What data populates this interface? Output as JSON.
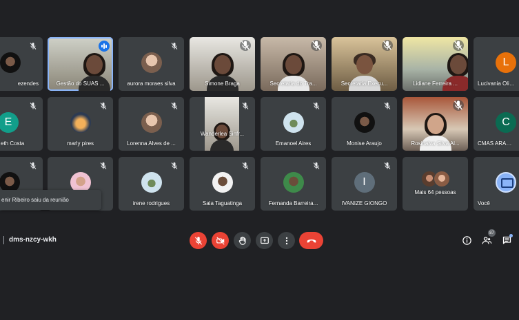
{
  "tiles": [
    {
      "name": "ezendes",
      "row": 0
    },
    {
      "name": "Gestão do SUAS ..."
    },
    {
      "name": "aurora moraes silva"
    },
    {
      "name": "Simone Braga"
    },
    {
      "name": "Secretaria do Tra..."
    },
    {
      "name": "Secretaria Execu..."
    },
    {
      "name": "Lidiane Ferreira ..."
    },
    {
      "name": "Lucivania Olive",
      "letter": "L"
    },
    {
      "name": "eth Costa",
      "letter": "E"
    },
    {
      "name": "marly pires"
    },
    {
      "name": "Lorenna Alves de ..."
    },
    {
      "name": "Wanderlea Sinfr..."
    },
    {
      "name": "Emanoel Aires"
    },
    {
      "name": "Monise Araujo"
    },
    {
      "name": "Rosinalva Silva Al..."
    },
    {
      "name": "CMAS ARAGUA",
      "letter": "C"
    },
    {
      "name": ""
    },
    {
      "name": ""
    },
    {
      "name": "irene rodrigues"
    },
    {
      "name": "Sala Taguatinga"
    },
    {
      "name": "Fernanda Barreira..."
    },
    {
      "name": "IVANIZE GIONGO",
      "letter": "I"
    },
    {
      "name": "Mais 64 pessoas"
    },
    {
      "name": "Você"
    }
  ],
  "toast": {
    "text": "enir Ribeiro saiu da reunião"
  },
  "meeting": {
    "code": "dms-nzcy-wkh"
  },
  "controls": {
    "participants_count": "87"
  },
  "colors": {
    "background": "#202124",
    "tile": "#3c4043",
    "danger": "#ea4335",
    "accent": "#8ab4f8"
  }
}
